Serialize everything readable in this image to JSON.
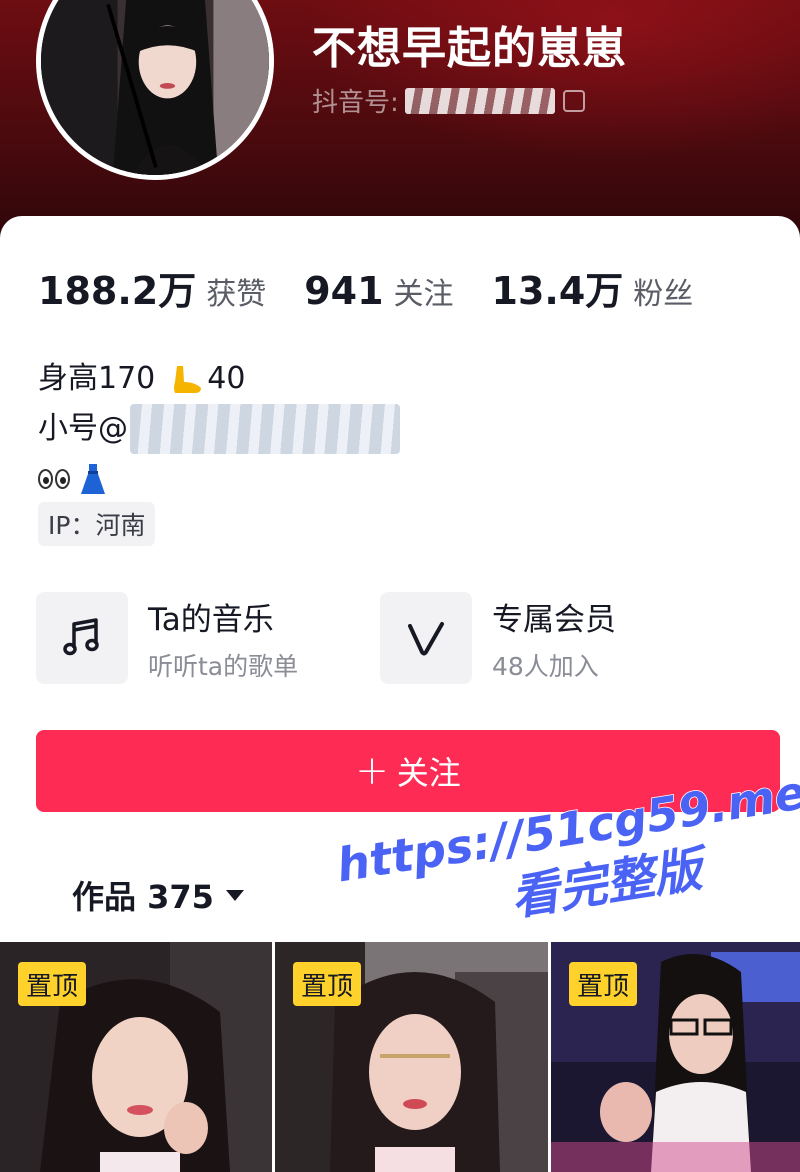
{
  "profile": {
    "nickname": "不想早起的崽崽",
    "id_label": "抖音号:",
    "stats": [
      {
        "value": "188.2万",
        "label": "获赞"
      },
      {
        "value": "941",
        "label": "关注"
      },
      {
        "value": "13.4万",
        "label": "粉丝"
      }
    ],
    "bio": {
      "height_text": "身高170",
      "foot_value": "40",
      "alt_account": "小号@"
    },
    "ip": "IP：河南"
  },
  "features": [
    {
      "title": "Ta的音乐",
      "subtitle": "听听ta的歌单",
      "icon": "music-note-icon"
    },
    {
      "title": "专属会员",
      "subtitle": "48人加入",
      "icon": "v-member-icon"
    }
  ],
  "follow_button": {
    "plus": "+",
    "label": "关注"
  },
  "works_tab": {
    "label": "作品 375"
  },
  "thumbnails": [
    {
      "pin_label": "置顶"
    },
    {
      "pin_label": "置顶"
    },
    {
      "pin_label": "置顶"
    }
  ],
  "watermark": {
    "url": "https://51cg59.me",
    "text": "看完整版",
    "color": "#4a63f5"
  },
  "colors": {
    "accent": "#fe2c55",
    "pin": "#fed22a",
    "header": "#4a0a0e"
  }
}
